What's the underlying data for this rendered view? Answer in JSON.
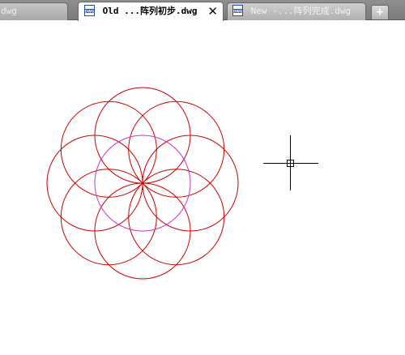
{
  "tabs": [
    {
      "label": "dwg",
      "state": "partial"
    },
    {
      "label": "Old ...阵列初步.dwg",
      "state": "active",
      "close": "✕"
    },
    {
      "label": "New -...阵列完成.dwg",
      "state": "inactive"
    }
  ],
  "new_tab_symbol": "+",
  "drawing": {
    "ring_color": "#cc0000",
    "center_circle_color": "#cc33cc",
    "crosshair_color": "#000000"
  },
  "icons": {
    "file": "dwg-file-icon",
    "close": "close-icon",
    "new_tab": "plus-icon",
    "cursor": "crosshair-cursor-icon"
  }
}
